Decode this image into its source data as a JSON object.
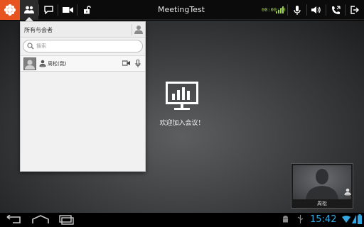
{
  "app": {
    "title": "MeetingTest",
    "timer": "00:00:20"
  },
  "toolbar": {
    "items": [
      {
        "name": "participants-icon",
        "active": true
      },
      {
        "name": "chat-icon"
      },
      {
        "name": "video-camera-icon"
      },
      {
        "name": "unlock-icon"
      }
    ],
    "right_items": [
      "microphone-icon",
      "speaker-icon",
      "call-transfer-icon",
      "exit-icon"
    ]
  },
  "panel": {
    "title": "所有与会者",
    "search": {
      "placeholder": "搜索",
      "value": ""
    },
    "participants": [
      {
        "name": "周松(我)",
        "role": "presenter",
        "video": true,
        "audio": true
      }
    ]
  },
  "main": {
    "welcome_text": "欢迎加入会议！"
  },
  "selfview": {
    "name": "周松"
  },
  "statusbar": {
    "time": "15:42"
  },
  "colors": {
    "accent": "#e8541f",
    "clock": "#35a7e0",
    "signal": "#9ad04a"
  }
}
